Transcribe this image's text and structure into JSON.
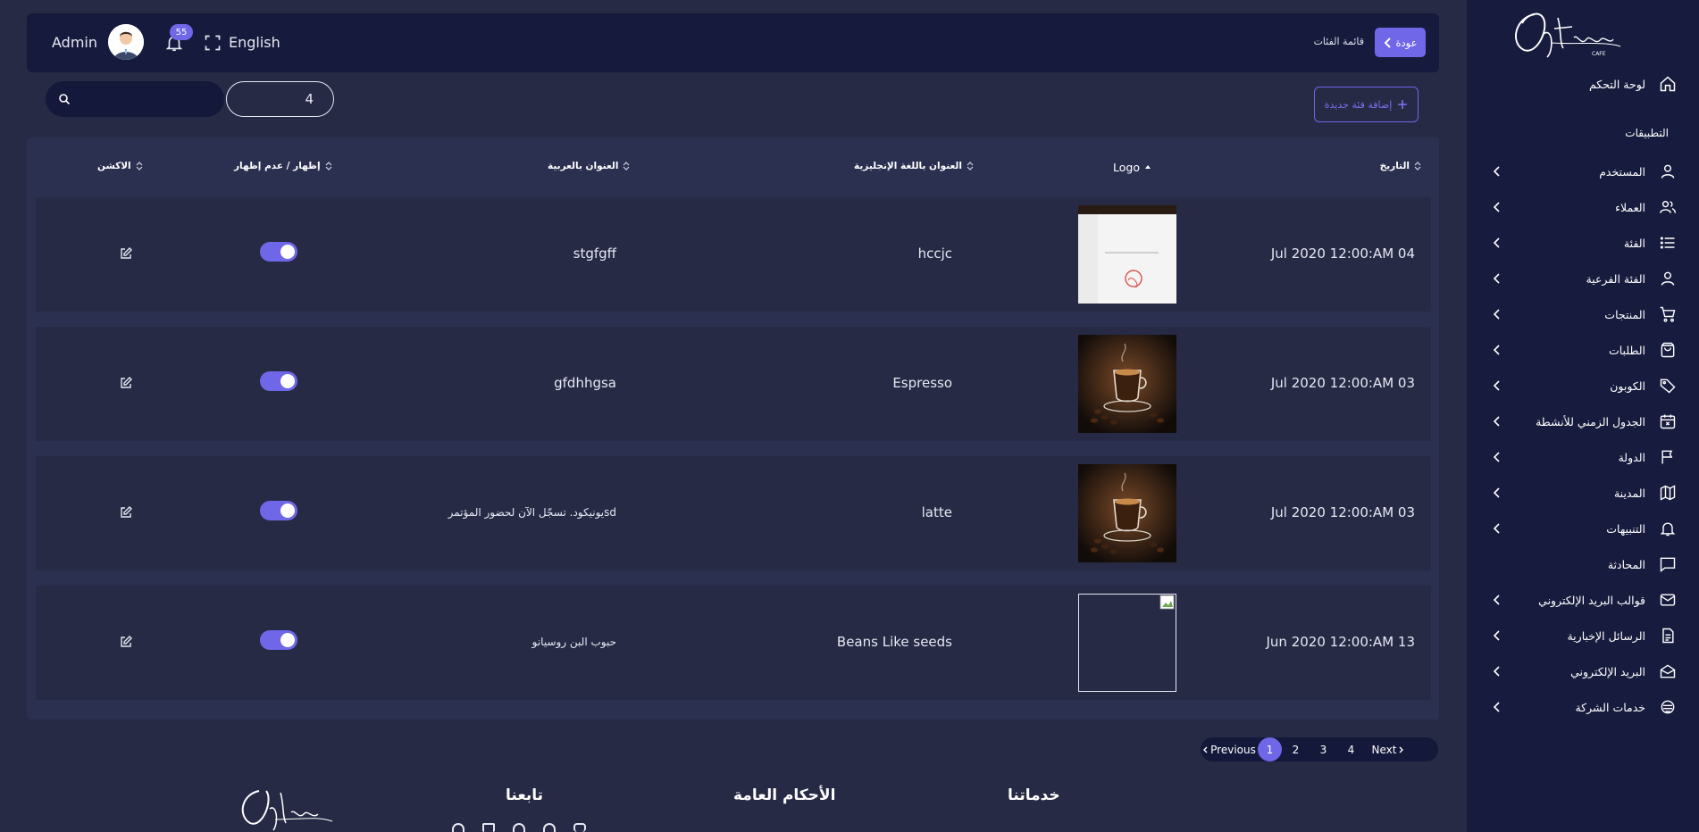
{
  "topbar": {
    "user_name": "Admin",
    "notification_count": "55",
    "language": "English",
    "back_label": "عودة",
    "breadcrumb": "قائمة الفئات"
  },
  "sidebar": {
    "brand": "Options Cafe",
    "section_label": "التطبيقات",
    "dashboard": "لوحة التحكم",
    "items": [
      {
        "label": "المستخدم",
        "icon": "user-icon",
        "has_submenu": true
      },
      {
        "label": "العملاء",
        "icon": "users-icon",
        "has_submenu": true
      },
      {
        "label": "الفئة",
        "icon": "list-icon",
        "has_submenu": true
      },
      {
        "label": "الفئة الفرعية",
        "icon": "user-icon",
        "has_submenu": true
      },
      {
        "label": "المنتجات",
        "icon": "cart-icon",
        "has_submenu": true
      },
      {
        "label": "الطلبات",
        "icon": "bag-icon",
        "has_submenu": true
      },
      {
        "label": "الكوبون",
        "icon": "tag-icon",
        "has_submenu": true
      },
      {
        "label": "الجدول الزمني للأنشطة",
        "icon": "calendar-icon",
        "has_submenu": true
      },
      {
        "label": "الدولة",
        "icon": "flag-icon",
        "has_submenu": true
      },
      {
        "label": "المدينة",
        "icon": "map-icon",
        "has_submenu": true
      },
      {
        "label": "التنبيهات",
        "icon": "bell-icon",
        "has_submenu": true
      },
      {
        "label": "المحادثة",
        "icon": "chat-icon",
        "has_submenu": false
      },
      {
        "label": "قوالب البريد الإلكتروني",
        "icon": "mail-icon",
        "has_submenu": true
      },
      {
        "label": "الرسائل الإخبارية",
        "icon": "document-icon",
        "has_submenu": true
      },
      {
        "label": "البريد الإلكتروني",
        "icon": "mail-open-icon",
        "has_submenu": true
      },
      {
        "label": "خدمات الشركة",
        "icon": "services-icon",
        "has_submenu": true
      }
    ]
  },
  "controls": {
    "add_category_label": "إضافة فئة جديدة",
    "per_page_value": "4",
    "search_value": ""
  },
  "table": {
    "headers": {
      "date": "التاريخ",
      "logo": "Logo",
      "title_en": "العنوان باللغة الإنجليزية",
      "title_ar": "العنوان بالعربية",
      "visibility": "إظهار / عدم إظهار",
      "action": "الاكشن"
    },
    "rows": [
      {
        "date": "Jul 2020 12:00:AM 04",
        "logo": "screenshot-thumbnail",
        "title_en": "hccjc",
        "title_ar": "stgfgff",
        "visible": true
      },
      {
        "date": "Jul 2020 12:00:AM 03",
        "logo": "espresso-photo",
        "title_en": "Espresso",
        "title_ar": "gfdhhgsa",
        "visible": true
      },
      {
        "date": "Jul 2020 12:00:AM 03",
        "logo": "espresso-photo",
        "title_en": "latte",
        "title_ar": "يونيكود. تسجّل الآن لحضور المؤتمرsd",
        "visible": true
      },
      {
        "date": "Jun 2020 12:00:AM 13",
        "logo": "broken-image",
        "title_en": "Beans Like seeds",
        "title_ar": "حبوب البن روسيانو",
        "visible": true
      }
    ]
  },
  "pagination": {
    "previous": "Previous",
    "next": "Next",
    "pages": [
      "1",
      "2",
      "3",
      "4"
    ],
    "current": "1"
  },
  "footer": {
    "services_heading": "خدماتنا",
    "terms_heading": "الأحكام العامة",
    "follow_heading": "تابعنا"
  },
  "colors": {
    "accent": "#6f67e8",
    "sidebar_bg": "#171b3d",
    "page_bg": "#262a45"
  }
}
